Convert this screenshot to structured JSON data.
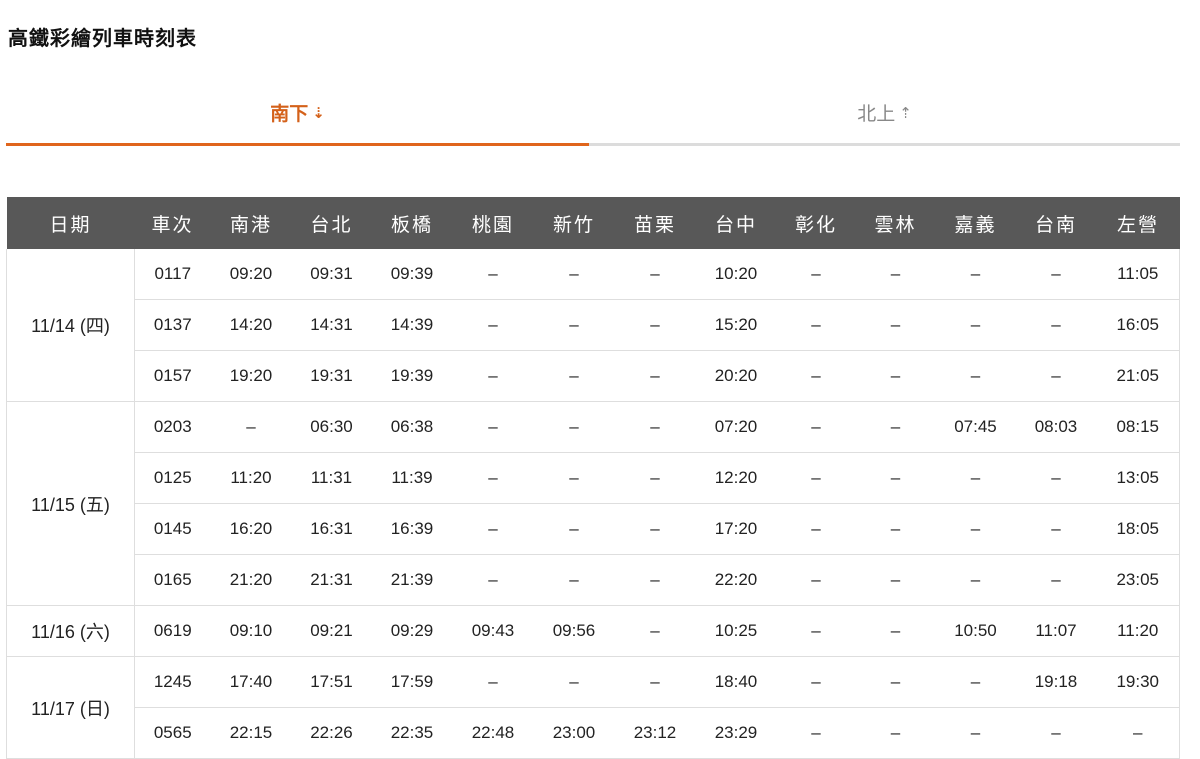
{
  "page": {
    "title": "高鐵彩繪列車時刻表"
  },
  "tabs": [
    {
      "label": "南下",
      "arrow": "⇣",
      "active": true
    },
    {
      "label": "北上",
      "arrow": "⇡",
      "active": false
    }
  ],
  "colors": {
    "accent": "#e0651c",
    "header_bg": "#585858",
    "inactive_tab": "#888888"
  },
  "table": {
    "headers": [
      "日期",
      "車次",
      "南港",
      "台北",
      "板橋",
      "桃園",
      "新竹",
      "苗栗",
      "台中",
      "彰化",
      "雲林",
      "嘉義",
      "台南",
      "左營"
    ],
    "groups": [
      {
        "date": "11/14 (四)",
        "rows": [
          [
            "0117",
            "09:20",
            "09:31",
            "09:39",
            "–",
            "–",
            "–",
            "10:20",
            "–",
            "–",
            "–",
            "–",
            "11:05"
          ],
          [
            "0137",
            "14:20",
            "14:31",
            "14:39",
            "–",
            "–",
            "–",
            "15:20",
            "–",
            "–",
            "–",
            "–",
            "16:05"
          ],
          [
            "0157",
            "19:20",
            "19:31",
            "19:39",
            "–",
            "–",
            "–",
            "20:20",
            "–",
            "–",
            "–",
            "–",
            "21:05"
          ]
        ]
      },
      {
        "date": "11/15 (五)",
        "rows": [
          [
            "0203",
            "–",
            "06:30",
            "06:38",
            "–",
            "–",
            "–",
            "07:20",
            "–",
            "–",
            "07:45",
            "08:03",
            "08:15"
          ],
          [
            "0125",
            "11:20",
            "11:31",
            "11:39",
            "–",
            "–",
            "–",
            "12:20",
            "–",
            "–",
            "–",
            "–",
            "13:05"
          ],
          [
            "0145",
            "16:20",
            "16:31",
            "16:39",
            "–",
            "–",
            "–",
            "17:20",
            "–",
            "–",
            "–",
            "–",
            "18:05"
          ],
          [
            "0165",
            "21:20",
            "21:31",
            "21:39",
            "–",
            "–",
            "–",
            "22:20",
            "–",
            "–",
            "–",
            "–",
            "23:05"
          ]
        ]
      },
      {
        "date": "11/16 (六)",
        "rows": [
          [
            "0619",
            "09:10",
            "09:21",
            "09:29",
            "09:43",
            "09:56",
            "–",
            "10:25",
            "–",
            "–",
            "10:50",
            "11:07",
            "11:20"
          ]
        ]
      },
      {
        "date": "11/17 (日)",
        "rows": [
          [
            "1245",
            "17:40",
            "17:51",
            "17:59",
            "–",
            "–",
            "–",
            "18:40",
            "–",
            "–",
            "–",
            "19:18",
            "19:30"
          ],
          [
            "0565",
            "22:15",
            "22:26",
            "22:35",
            "22:48",
            "23:00",
            "23:12",
            "23:29",
            "–",
            "–",
            "–",
            "–",
            "–"
          ]
        ]
      }
    ]
  }
}
